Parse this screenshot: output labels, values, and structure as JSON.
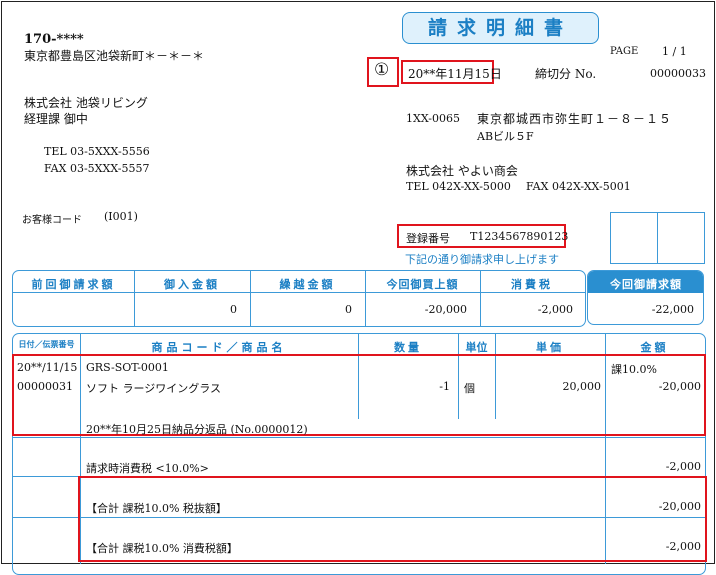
{
  "doc": {
    "title": "請求明細書",
    "page_label": "PAGE",
    "page_value": "1 / 1",
    "marker": "①",
    "date": "20**年11月15日",
    "cutoff_label": "締切分 No.",
    "doc_no": "00000033"
  },
  "customer": {
    "postal": "170-****",
    "address": "東京都豊島区池袋新町＊－＊－＊",
    "company": "株式会社 池袋リビング",
    "dept": "経理課 御中",
    "tel": "TEL 03-5XXX-5556",
    "fax": "FAX 03-5XXX-5557",
    "code_label": "お客様コード",
    "code": "(I001)"
  },
  "issuer": {
    "postal": "1XX-0065",
    "address1": "東京都城西市弥生町１－８－１５",
    "address2": "ABビル５F",
    "company": "株式会社 やよい商会",
    "tel": "TEL 042X-XX-5000",
    "fax": "FAX 042X-XX-5001",
    "reg_label": "登録番号",
    "reg_no": "T1234567890123",
    "note": "下記の通り御請求申し上げます"
  },
  "summary": {
    "headers": [
      "前回御請求額",
      "御入金額",
      "繰越金額",
      "今回御買上額",
      "消費税",
      "今回御請求額"
    ],
    "values": [
      "",
      "0",
      "0",
      "-20,000",
      "-2,000",
      "-22,000"
    ]
  },
  "detail": {
    "headers": {
      "date": "日付／伝票番号",
      "product": "商品コード／商品名",
      "qty": "数量",
      "unit": "単位",
      "price": "単価",
      "amount": "金額"
    },
    "rows": {
      "date": "20**/11/15",
      "slip": "00000031",
      "code": "GRS-SOT-0001",
      "name": "ソフト ラージワイングラス",
      "qty": "-1",
      "unit": "個",
      "price": "20,000",
      "tax_type": "課10.0%",
      "amount": "-20,000",
      "return_note": "20**年10月25日納品分返品 (No.0000012)",
      "tax_line_label": "請求時消費税 <10.0%>",
      "tax_line_amount": "-2,000",
      "total_ex_label": "【合計 課税10.0% 税抜額】",
      "total_ex_amount": "-20,000",
      "total_tax_label": "【合計 課税10.0% 消費税額】",
      "total_tax_amount": "-2,000"
    }
  }
}
